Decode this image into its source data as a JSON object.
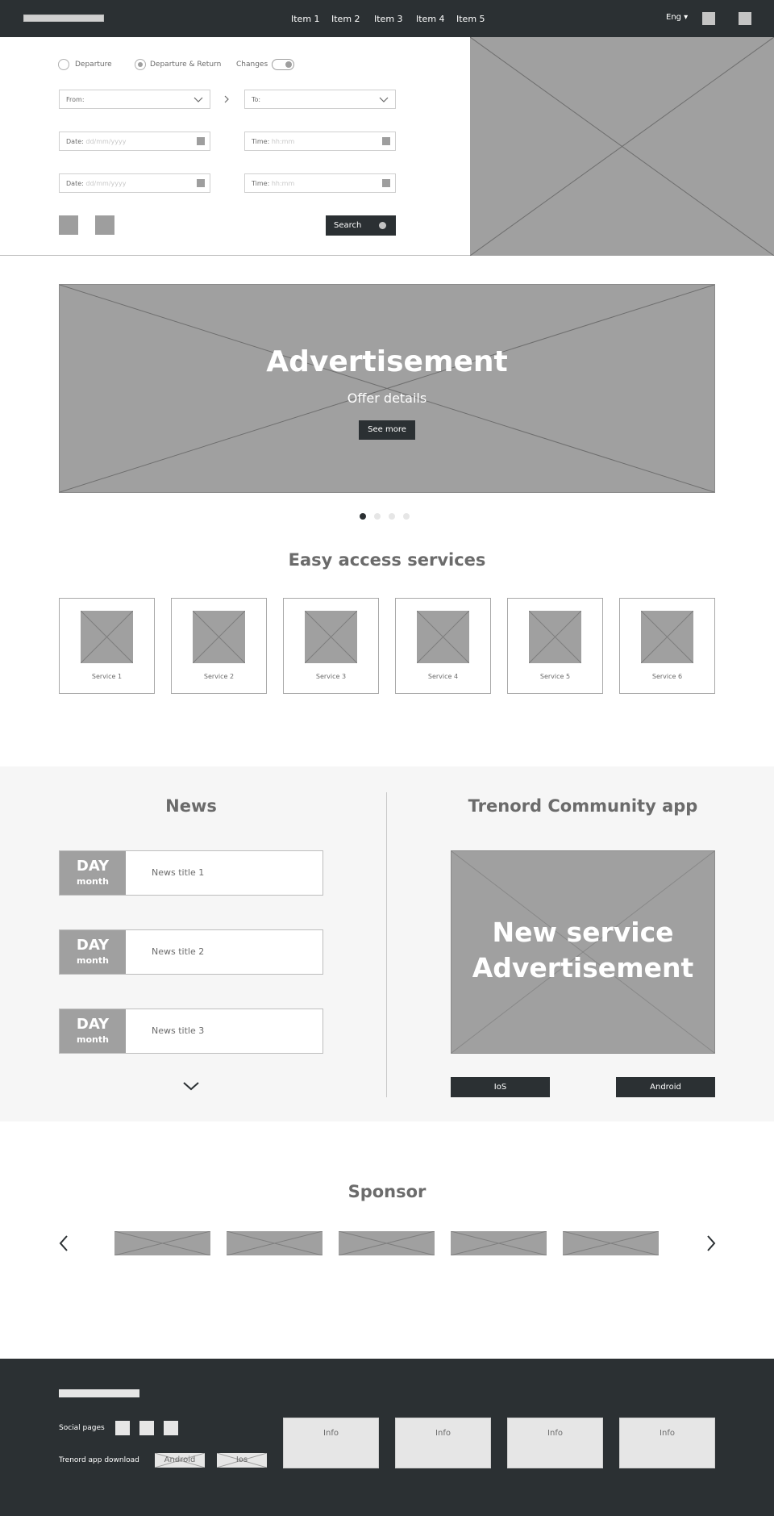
{
  "header": {
    "nav": [
      "Item 1",
      "Item 2",
      "Item 3",
      "Item 4",
      "Item 5"
    ],
    "language": "Eng ▾"
  },
  "booking": {
    "options": {
      "departure": "Departure",
      "departure_return": "Departure & Return",
      "changes": "Changes"
    },
    "from_label": "From:",
    "to_label": "To:",
    "date_label": "Date:",
    "date_placeholder": "dd/mm/yyyy",
    "time_label": "Time:",
    "time_placeholder": "hh:mm",
    "search_label": "Search"
  },
  "ad": {
    "title": "Advertisement",
    "subtitle": "Offer details",
    "cta": "See more",
    "carousel_count": 4,
    "carousel_active": 1
  },
  "services": {
    "title": "Easy access services",
    "items": [
      "Service 1",
      "Service 2",
      "Service 3",
      "Service 4",
      "Service 5",
      "Service 6"
    ]
  },
  "news": {
    "title": "News",
    "items": [
      {
        "day": "DAY",
        "month": "month",
        "title": "News title 1"
      },
      {
        "day": "DAY",
        "month": "month",
        "title": "News title 2"
      },
      {
        "day": "DAY",
        "month": "month",
        "title": "News title 3"
      }
    ]
  },
  "app": {
    "title": "Trenord Community app",
    "ad_line1": "New service",
    "ad_line2": "Advertisement",
    "ios": "IoS",
    "android": "Android"
  },
  "sponsor": {
    "title": "Sponsor"
  },
  "footer": {
    "social_label": "Social pages",
    "download_label": "Trenord app download",
    "android": "Android",
    "ios": "Ios",
    "info": [
      "Info",
      "Info",
      "Info",
      "Info"
    ]
  },
  "colors": {
    "dark": "#2b3033",
    "placeholder": "#a0a0a0",
    "light": "#f6f6f6"
  }
}
